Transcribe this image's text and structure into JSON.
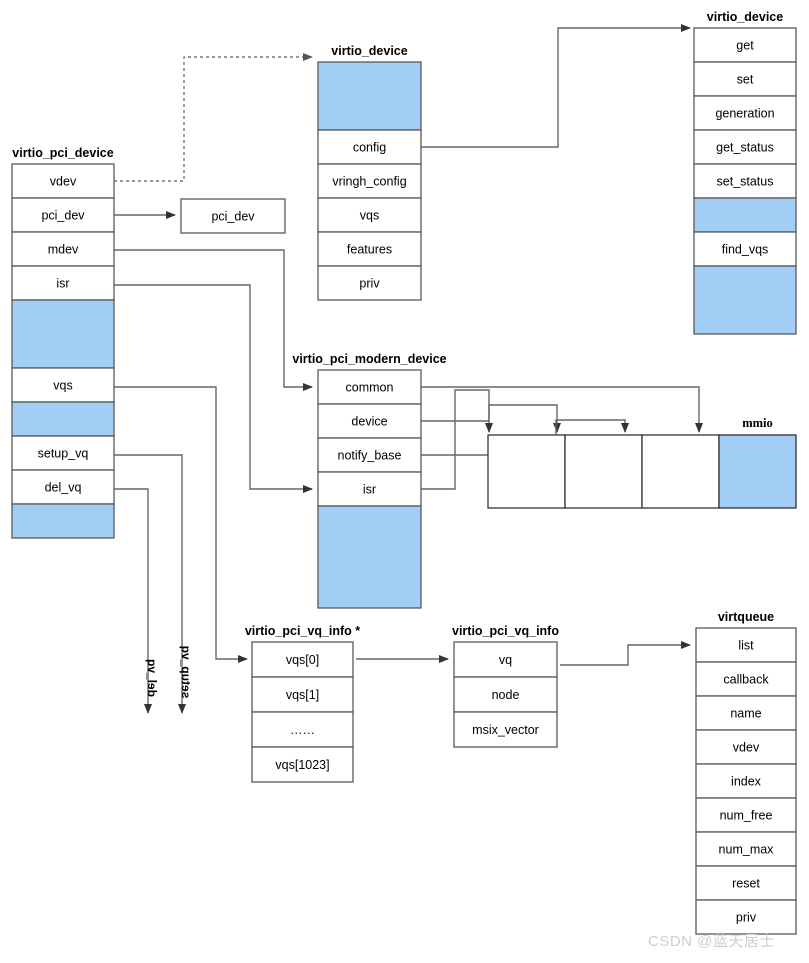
{
  "diagram": {
    "title": "virtio pci device structure relationships",
    "colors": {
      "blue_fill": "#a2cdf5",
      "stroke": "#666666",
      "dark_stroke": "#1a1a1a",
      "text": "#000000",
      "watermark": "#cfcfcf"
    },
    "watermark": "CSDN @蓝天居士"
  },
  "boxes": {
    "virtio_pci_device": {
      "title": "virtio_pci_device",
      "rows": [
        {
          "label": "vdev",
          "fill": "white"
        },
        {
          "label": "pci_dev",
          "fill": "white"
        },
        {
          "label": "mdev",
          "fill": "white"
        },
        {
          "label": "isr",
          "fill": "white"
        },
        {
          "label": "",
          "fill": "blue",
          "span": 2
        },
        {
          "label": "vqs",
          "fill": "white"
        },
        {
          "label": "",
          "fill": "blue"
        },
        {
          "label": "setup_vq",
          "fill": "white"
        },
        {
          "label": "del_vq",
          "fill": "white"
        },
        {
          "label": "",
          "fill": "blue"
        }
      ]
    },
    "pci_dev": {
      "title": "",
      "rows": [
        {
          "label": "pci_dev",
          "fill": "white"
        }
      ]
    },
    "virtio_device_mid": {
      "title": "virtio_device",
      "rows": [
        {
          "label": "",
          "fill": "blue",
          "span": 2
        },
        {
          "label": "config",
          "fill": "white"
        },
        {
          "label": "vringh_config",
          "fill": "white"
        },
        {
          "label": "vqs",
          "fill": "white"
        },
        {
          "label": "features",
          "fill": "white"
        },
        {
          "label": "priv",
          "fill": "white"
        }
      ]
    },
    "virtio_device_right": {
      "title": "virtio_device",
      "rows": [
        {
          "label": "get",
          "fill": "white"
        },
        {
          "label": "set",
          "fill": "white"
        },
        {
          "label": "generation",
          "fill": "white"
        },
        {
          "label": "get_status",
          "fill": "white"
        },
        {
          "label": "set_status",
          "fill": "white"
        },
        {
          "label": "",
          "fill": "blue"
        },
        {
          "label": "find_vqs",
          "fill": "white"
        },
        {
          "label": "",
          "fill": "blue",
          "span": 2
        }
      ]
    },
    "virtio_pci_modern_device": {
      "title": "virtio_pci_modern_device",
      "rows": [
        {
          "label": "common",
          "fill": "white"
        },
        {
          "label": "device",
          "fill": "white"
        },
        {
          "label": "notify_base",
          "fill": "white"
        },
        {
          "label": "isr",
          "fill": "white"
        },
        {
          "label": "",
          "fill": "blue",
          "span": 3
        }
      ]
    },
    "mmio": {
      "title": "mmio",
      "cells": [
        {
          "label": "",
          "fill": "white"
        },
        {
          "label": "",
          "fill": "white"
        },
        {
          "label": "",
          "fill": "white"
        },
        {
          "label": "",
          "fill": "blue"
        }
      ]
    },
    "vq_info_array": {
      "title": "virtio_pci_vq_info *",
      "rows": [
        {
          "label": "vqs[0]",
          "fill": "white"
        },
        {
          "label": "vqs[1]",
          "fill": "white"
        },
        {
          "label": "……",
          "fill": "white"
        },
        {
          "label": "vqs[1023]",
          "fill": "white"
        }
      ]
    },
    "vq_info": {
      "title": "virtio_pci_vq_info",
      "rows": [
        {
          "label": "vq",
          "fill": "white"
        },
        {
          "label": "node",
          "fill": "white"
        },
        {
          "label": "msix_vector",
          "fill": "white"
        }
      ]
    },
    "virtqueue": {
      "title": "virtqueue",
      "rows": [
        {
          "label": "list",
          "fill": "white"
        },
        {
          "label": "callback",
          "fill": "white"
        },
        {
          "label": "name",
          "fill": "white"
        },
        {
          "label": "vdev",
          "fill": "white"
        },
        {
          "label": "index",
          "fill": "white"
        },
        {
          "label": "num_free",
          "fill": "white"
        },
        {
          "label": "num_max",
          "fill": "white"
        },
        {
          "label": "reset",
          "fill": "white"
        },
        {
          "label": "priv",
          "fill": "white"
        }
      ]
    }
  },
  "edge_labels": {
    "del_vq": "del_vq",
    "setup_vq": "setup_vq"
  }
}
